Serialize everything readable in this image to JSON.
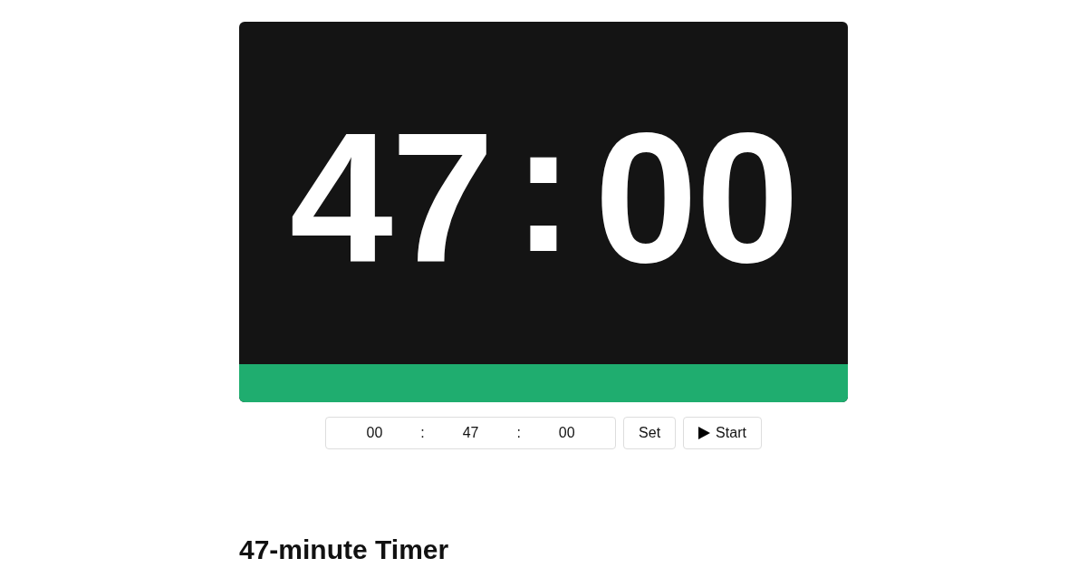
{
  "display": {
    "minutes": "47",
    "separator": ":",
    "seconds": "00"
  },
  "progress": {
    "level": 1
  },
  "time_inputs": [
    {
      "value": "00"
    },
    {
      "value": "47"
    },
    {
      "value": "00"
    }
  ],
  "input_separators": [
    ":",
    ":"
  ],
  "buttons": [
    {
      "label": "Set",
      "kind": "plain"
    },
    {
      "label": "Start",
      "kind": "play"
    }
  ],
  "heading": "47-minute Timer"
}
